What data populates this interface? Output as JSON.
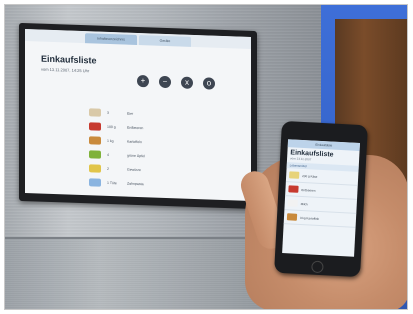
{
  "monitor": {
    "tabs": [
      "Inhaltsverzeichnis",
      "Geräte"
    ],
    "title": "Einkaufsliste",
    "date": "vom 13.11.2007, 14:25 Uhr",
    "buttons": [
      "+",
      "−",
      "x",
      "o"
    ],
    "rows": [
      {
        "qty": "3",
        "name": "Eier",
        "note": "",
        "color": "#d9c9a8"
      },
      {
        "qty": "100 g",
        "name": "Erdbeeren",
        "note": "",
        "color": "#c73a2f"
      },
      {
        "qty": "1 kg",
        "name": "Kartoffeln",
        "note": "",
        "color": "#c98a3c"
      },
      {
        "qty": "4",
        "name": "grüne Äpfel",
        "note": "",
        "color": "#7fb23a"
      },
      {
        "qty": "2",
        "name": "Gewürze",
        "note": "",
        "color": "#e1c54a"
      },
      {
        "qty": "1 Tüte",
        "name": "Zahnpasta",
        "note": "",
        "color": "#8ab4e0"
      }
    ]
  },
  "phone": {
    "tabs": "Einkaufsliste",
    "title": "Einkaufsliste",
    "date": "vom 13.11.2007",
    "subheader": "Lebensmittel",
    "rows": [
      {
        "label": "200 g Käse",
        "color": "#e7d37a"
      },
      {
        "label": "Erdbeeren",
        "color": "#c73a2f"
      },
      {
        "label": "Milch",
        "color": "#f2f2f2"
      },
      {
        "label": "3 kg Kartoffeln",
        "color": "#c98a3c"
      }
    ]
  }
}
